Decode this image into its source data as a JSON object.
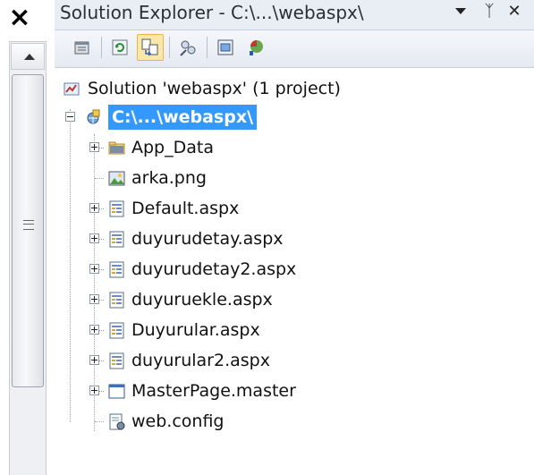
{
  "window": {
    "title": "Solution Explorer - C:\\...\\webaspx\\",
    "close_glyph": "✕",
    "pin_glyph": "ᛉ",
    "x_glyph": "×"
  },
  "toolbar": {
    "buttons": [
      {
        "name": "properties-icon"
      },
      {
        "name": "refresh-icon"
      },
      {
        "name": "nest-related-files-icon",
        "active": true
      },
      {
        "name": "view-class-diagram-icon"
      },
      {
        "name": "view-designer-icon"
      },
      {
        "name": "asp-net-configuration-icon"
      }
    ]
  },
  "tree": {
    "solution": "Solution 'webaspx' (1 project)",
    "project": "C:\\...\\webaspx\\",
    "items": [
      {
        "label": "App_Data",
        "icon": "folder-icon",
        "expandable": true
      },
      {
        "label": "arka.png",
        "icon": "image-icon",
        "expandable": false
      },
      {
        "label": "Default.aspx",
        "icon": "aspx-page-icon",
        "expandable": true
      },
      {
        "label": "duyurudetay.aspx",
        "icon": "aspx-page-icon",
        "expandable": true
      },
      {
        "label": "duyurudetay2.aspx",
        "icon": "aspx-page-icon",
        "expandable": true
      },
      {
        "label": "duyuruekle.aspx",
        "icon": "aspx-page-icon",
        "expandable": true
      },
      {
        "label": "Duyurular.aspx",
        "icon": "aspx-page-icon",
        "expandable": true
      },
      {
        "label": "duyurular2.aspx",
        "icon": "aspx-page-icon",
        "expandable": true
      },
      {
        "label": "MasterPage.master",
        "icon": "master-page-icon",
        "expandable": true
      },
      {
        "label": "web.config",
        "icon": "config-file-icon",
        "expandable": false
      }
    ]
  },
  "colors": {
    "selection": "#3399ff",
    "titlebar": "#e9edf4"
  }
}
